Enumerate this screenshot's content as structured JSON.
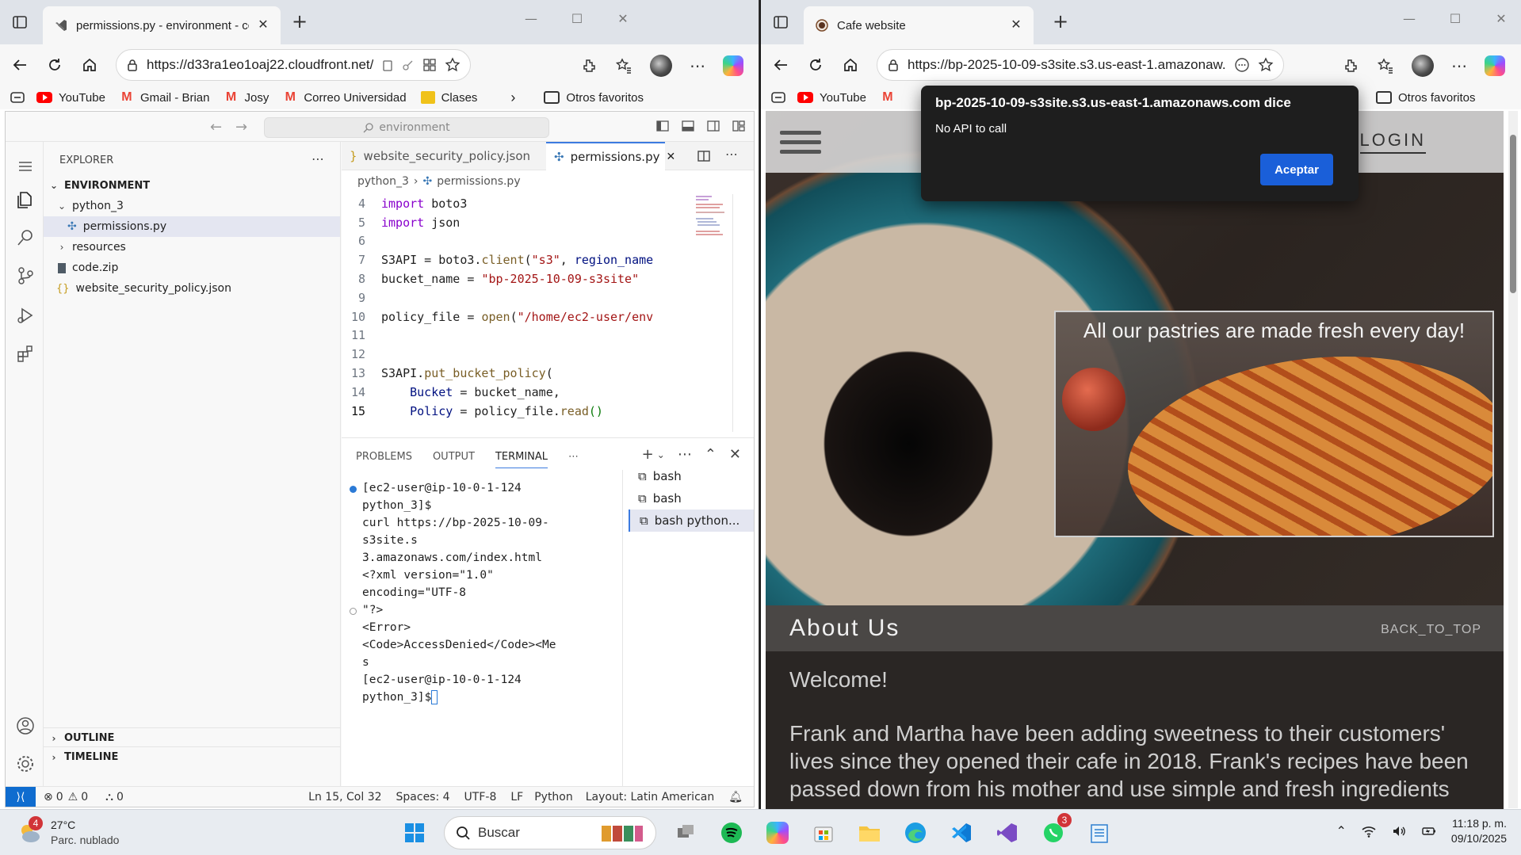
{
  "left_browser": {
    "tab_title": "permissions.py - environment - cc",
    "url": "https://d33ra1eo1oaj22.cloudfront.net/?fold...",
    "bookmarks": [
      {
        "label": "YouTube",
        "icon": "youtube-icon"
      },
      {
        "label": "Gmail - Brian",
        "icon": "gmail-icon"
      },
      {
        "label": "Josy",
        "icon": "gmail-icon"
      },
      {
        "label": "Correo Universidad",
        "icon": "gmail-icon"
      },
      {
        "label": "Clases",
        "icon": "clases-icon"
      }
    ],
    "other_favorites": "Otros favoritos"
  },
  "vscode": {
    "command_center": "environment",
    "explorer": {
      "title": "EXPLORER",
      "root": "ENVIRONMENT",
      "items": [
        {
          "label": "python_3",
          "type": "folder-open"
        },
        {
          "label": "permissions.py",
          "type": "python-file"
        },
        {
          "label": "resources",
          "type": "folder"
        },
        {
          "label": "code.zip",
          "type": "zip-file"
        },
        {
          "label": "website_security_policy.json",
          "type": "json-file"
        }
      ],
      "outline": "OUTLINE",
      "timeline": "TIMELINE"
    },
    "editor_tabs": [
      {
        "label": "website_security_policy.json",
        "active": false
      },
      {
        "label": "permissions.py",
        "active": true
      }
    ],
    "breadcrumb": [
      "python_3",
      "permissions.py"
    ],
    "code_lines": [
      {
        "n": "4",
        "text": "import boto3"
      },
      {
        "n": "5",
        "text": "import json"
      },
      {
        "n": "6",
        "text": ""
      },
      {
        "n": "7",
        "text": "S3API = boto3.client(\"s3\", region_name"
      },
      {
        "n": "8",
        "text": "bucket_name = \"bp-2025-10-09-s3site\""
      },
      {
        "n": "9",
        "text": ""
      },
      {
        "n": "10",
        "text": "policy_file = open(\"/home/ec2-user/env"
      },
      {
        "n": "11",
        "text": ""
      },
      {
        "n": "12",
        "text": ""
      },
      {
        "n": "13",
        "text": "S3API.put_bucket_policy("
      },
      {
        "n": "14",
        "text": "    Bucket = bucket_name,"
      },
      {
        "n": "15",
        "text": "    Policy = policy_file.read()"
      }
    ],
    "panel_tabs": [
      "PROBLEMS",
      "OUTPUT",
      "TERMINAL"
    ],
    "active_panel_tab": "TERMINAL",
    "terminal_lines": [
      "[ec2-user@ip-10-0-1-124 python_3]$",
      "curl https://bp-2025-10-09-s3site.s",
      "3.amazonaws.com/index.html",
      "<?xml version=\"1.0\" encoding=\"UTF-8",
      "\"?>",
      "<Error><Code>AccessDenied</Code><Me",
      "s",
      "[ec2-user@ip-10-0-1-124 python_3]$"
    ],
    "terminals": [
      "bash",
      "bash",
      "bash python..."
    ],
    "status": {
      "errors": "0",
      "warnings": "0",
      "ports": "0",
      "position": "Ln 15, Col 32",
      "spaces": "Spaces: 4",
      "encoding": "UTF-8",
      "eol": "LF",
      "language": "Python",
      "layout": "Layout: Latin American"
    }
  },
  "right_browser": {
    "tab_title": "Cafe website",
    "url": "https://bp-2025-10-09-s3site.s3.us-east-1.amazonaw...",
    "bookmarks": [
      {
        "label": "YouTube",
        "icon": "youtube-icon"
      }
    ],
    "other_favorites": "Otros favoritos"
  },
  "cafe": {
    "login": "LOGIN",
    "promo": "All our pastries are made fresh every day!",
    "about_heading": "About Us",
    "back_to_top": "BACK_TO_TOP",
    "welcome": "Welcome!",
    "story": "Frank and Martha have been adding sweetness to their customers' lives since they opened their cafe in 2018. Frank's recipes have been passed down from his mother and use simple and fresh ingredients"
  },
  "dialog": {
    "title": "bp-2025-10-09-s3site.s3.us-east-1.amazonaws.com dice",
    "message": "No API to call",
    "button": "Aceptar"
  },
  "taskbar": {
    "weather_temp": "27°C",
    "weather_desc": "Parc. nublado",
    "weather_badge": "4",
    "search": "Buscar",
    "whatsapp_badge": "3",
    "time": "11:18 p. m.",
    "date": "09/10/2025"
  },
  "colors": {
    "accent_blue": "#1a5fd9",
    "vscode_remote": "#0f6ccf"
  }
}
